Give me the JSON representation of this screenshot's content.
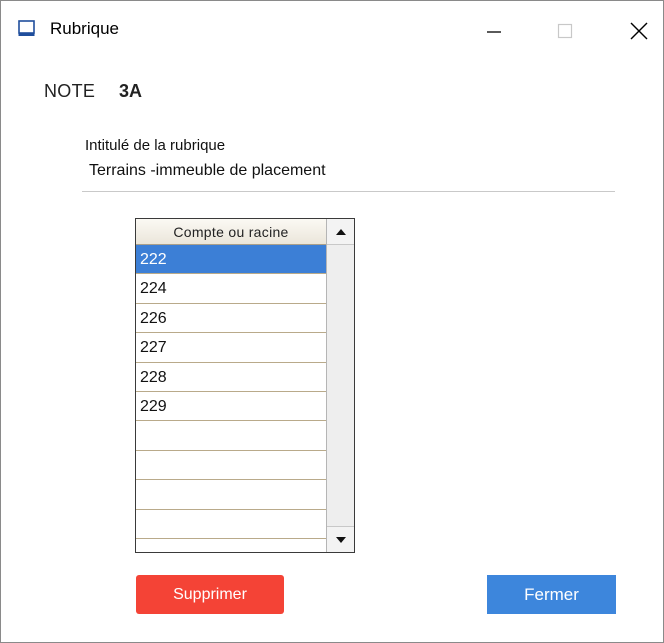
{
  "window": {
    "title": "Rubrique",
    "icon": "window-app-icon",
    "controls": {
      "minimize_icon": "minimize-icon",
      "maximize_icon": "maximize-icon",
      "close_icon": "close-icon"
    }
  },
  "note": {
    "label": "NOTE",
    "value": "3A"
  },
  "rubrique": {
    "label": "Intitulé de la rubrique",
    "value": "Terrains -immeuble de placement"
  },
  "table": {
    "header": "Compte ou racine",
    "rows": [
      "222",
      "224",
      "226",
      "227",
      "228",
      "229",
      "",
      "",
      "",
      ""
    ],
    "selected_index": 0
  },
  "buttons": {
    "delete_label": "Supprimer",
    "close_label": "Fermer"
  },
  "colors": {
    "selection": "#3c7fd6",
    "delete_button": "#f44336",
    "close_button": "#3d86dc"
  }
}
